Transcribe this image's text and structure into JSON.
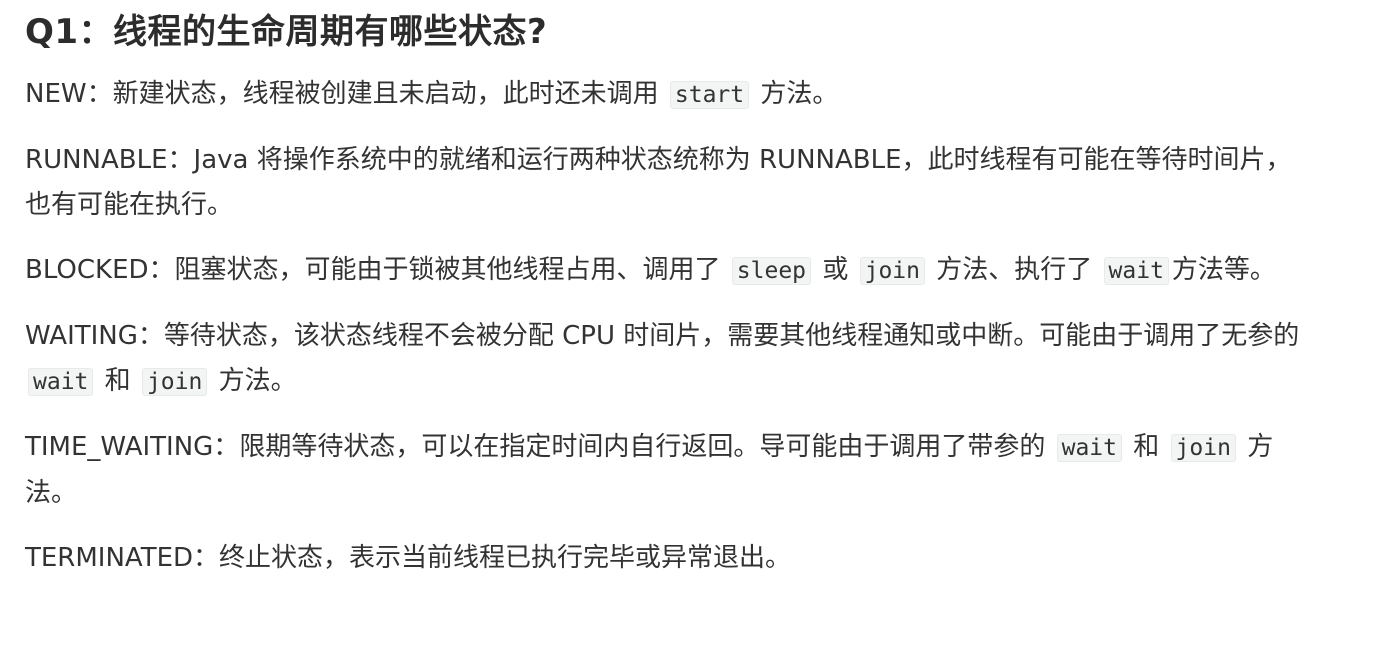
{
  "title": "Q1：线程的生命周期有哪些状态?",
  "paragraphs": {
    "new": {
      "label": "NEW：",
      "t1": "新建状态，线程被创建且未启动，此时还未调用",
      "c1": "start",
      "t2": "方法。"
    },
    "runnable": {
      "label": "RUNNABLE：",
      "t1": "Java 将操作系统中的就绪和运行两种状态统称为 RUNNABLE，此时线程有可能在等待时间片，也有可能在执行。"
    },
    "blocked": {
      "label": "BLOCKED：",
      "t1": "阻塞状态，可能由于锁被其他线程占用、调用了",
      "c1": "sleep",
      "t2": "或",
      "c2": "join",
      "t3": "方法、执行了",
      "c3": "wait",
      "t4": "方法等。"
    },
    "waiting": {
      "label": "WAITING：",
      "t1": "等待状态，该状态线程不会被分配 CPU 时间片，需要其他线程通知或中断。可能由于调用了无参的",
      "c1": "wait",
      "t2": "和",
      "c2": "join",
      "t3": "方法。"
    },
    "time_waiting": {
      "label": "TIME_WAITING：",
      "t1": "限期等待状态，可以在指定时间内自行返回。导可能由于调用了带参的",
      "c1": "wait",
      "t2": "和",
      "c2": "join",
      "t3": "方法。"
    },
    "terminated": {
      "label": "TERMINATED：",
      "t1": "终止状态，表示当前线程已执行完毕或异常退出。"
    }
  }
}
